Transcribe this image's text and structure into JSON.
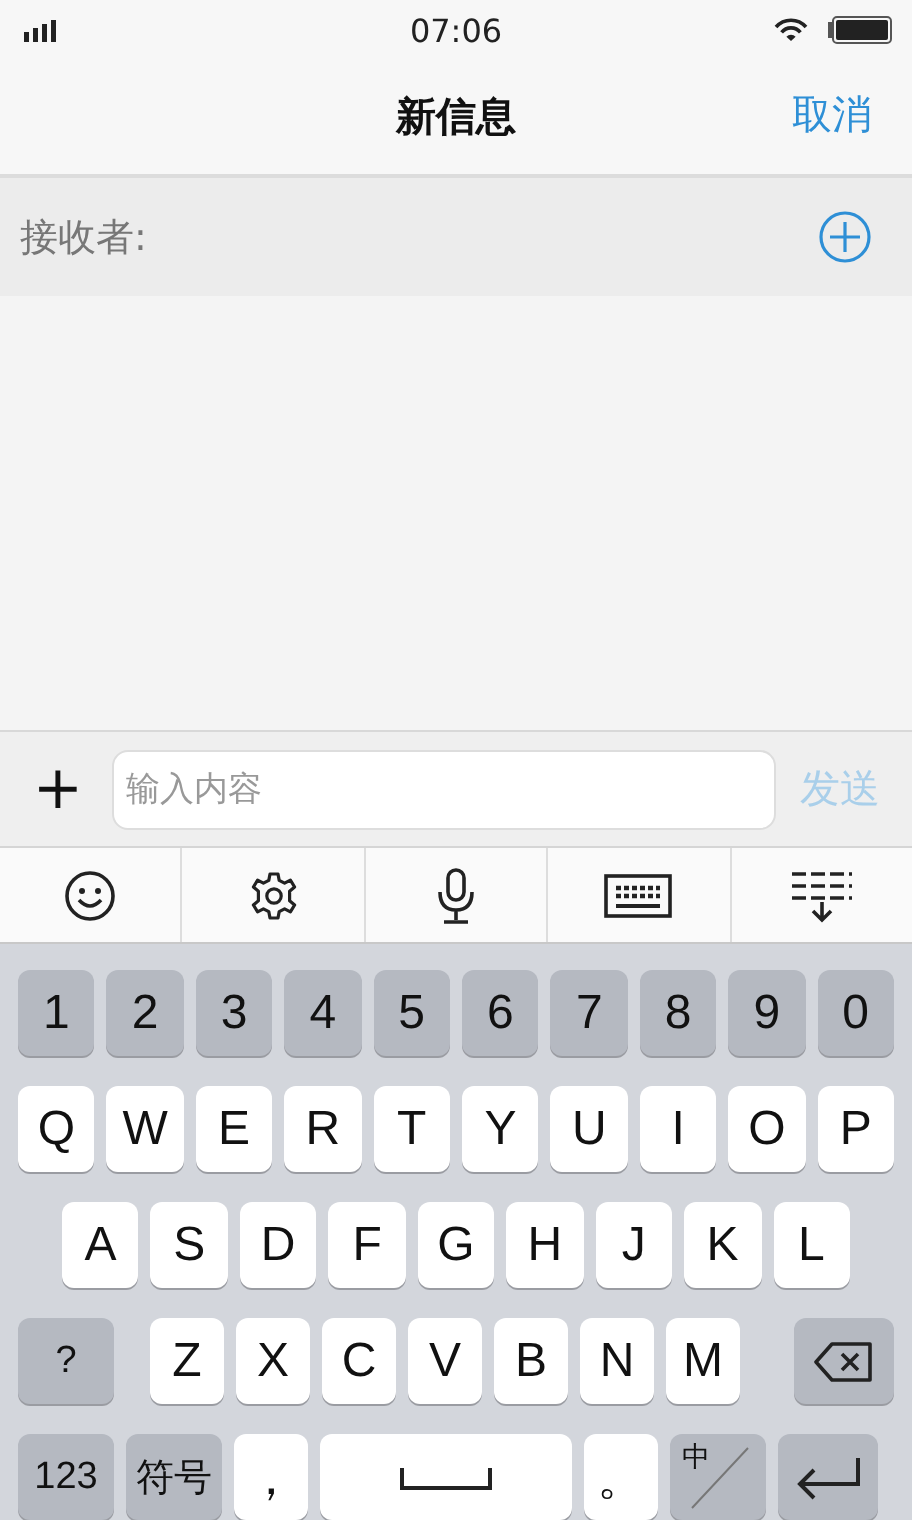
{
  "status_bar": {
    "time": "07:06"
  },
  "nav": {
    "title": "新信息",
    "cancel": "取消"
  },
  "recipient": {
    "label": "接收者:"
  },
  "compose": {
    "plus": "+",
    "placeholder": "输入内容",
    "send": "发送",
    "send_disabled": true
  },
  "keyboard": {
    "rows": [
      [
        {
          "label": "1",
          "kind": "dark"
        },
        {
          "label": "2",
          "kind": "dark"
        },
        {
          "label": "3",
          "kind": "dark"
        },
        {
          "label": "4",
          "kind": "dark"
        },
        {
          "label": "5",
          "kind": "dark"
        },
        {
          "label": "6",
          "kind": "dark"
        },
        {
          "label": "7",
          "kind": "dark"
        },
        {
          "label": "8",
          "kind": "dark"
        },
        {
          "label": "9",
          "kind": "dark"
        },
        {
          "label": "0",
          "kind": "dark"
        }
      ],
      [
        {
          "label": "Q",
          "kind": "char"
        },
        {
          "label": "W",
          "kind": "char"
        },
        {
          "label": "E",
          "kind": "char"
        },
        {
          "label": "R",
          "kind": "char"
        },
        {
          "label": "T",
          "kind": "char"
        },
        {
          "label": "Y",
          "kind": "char"
        },
        {
          "label": "U",
          "kind": "char"
        },
        {
          "label": "I",
          "kind": "char"
        },
        {
          "label": "O",
          "kind": "char"
        },
        {
          "label": "P",
          "kind": "char"
        }
      ],
      [
        {
          "label": "A",
          "kind": "char"
        },
        {
          "label": "S",
          "kind": "char"
        },
        {
          "label": "D",
          "kind": "char"
        },
        {
          "label": "F",
          "kind": "char"
        },
        {
          "label": "G",
          "kind": "char"
        },
        {
          "label": "H",
          "kind": "char"
        },
        {
          "label": "J",
          "kind": "char"
        },
        {
          "label": "K",
          "kind": "char"
        },
        {
          "label": "L",
          "kind": "char"
        }
      ],
      [
        {
          "label": "?",
          "kind": "func"
        },
        {
          "label": "Z",
          "kind": "char"
        },
        {
          "label": "X",
          "kind": "char"
        },
        {
          "label": "C",
          "kind": "char"
        },
        {
          "label": "V",
          "kind": "char"
        },
        {
          "label": "B",
          "kind": "char"
        },
        {
          "label": "N",
          "kind": "char"
        },
        {
          "label": "M",
          "kind": "char"
        },
        {
          "kind": "backspace"
        }
      ],
      [
        {
          "label": "123",
          "kind": "func"
        },
        {
          "label": "符号",
          "kind": "func"
        },
        {
          "label": "，",
          "kind": "punct"
        },
        {
          "kind": "space"
        },
        {
          "label": "。",
          "kind": "punct"
        },
        {
          "label": "中",
          "kind": "lang"
        },
        {
          "kind": "return"
        }
      ]
    ]
  }
}
